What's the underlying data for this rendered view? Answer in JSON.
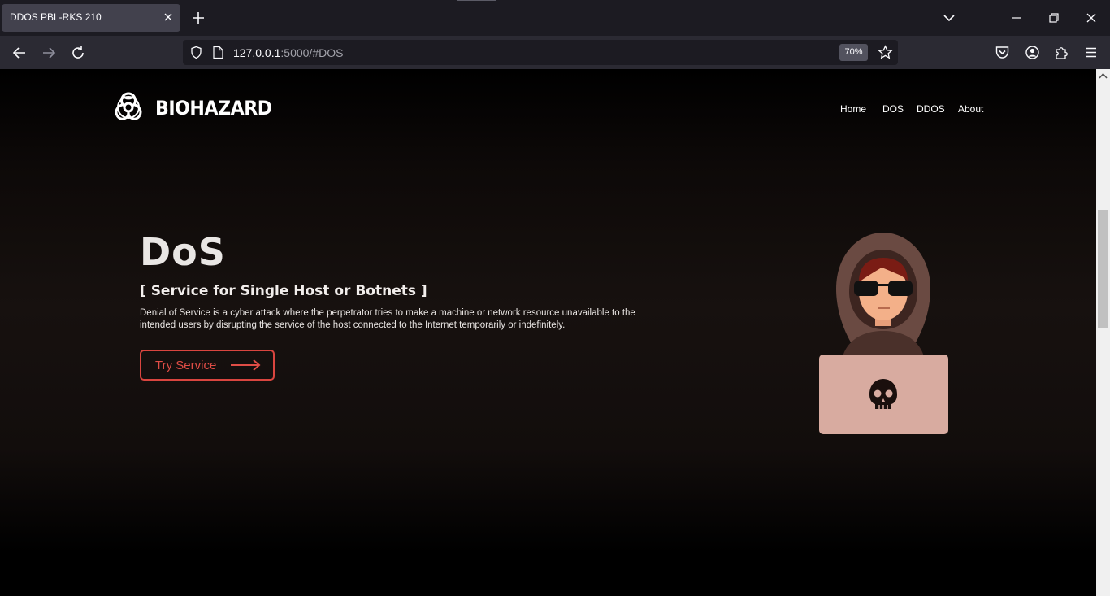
{
  "browser": {
    "tab_title": "DDOS PBL-RKS 210",
    "url_host": "127.0.0.1",
    "url_rest": ":5000/#DOS",
    "zoom": "70%"
  },
  "site": {
    "logo_text": "BIOHAZARD",
    "nav": [
      "Home",
      "DOS",
      "DDOS",
      "About"
    ]
  },
  "hero": {
    "title": "DoS",
    "subtitle": "[ Service for Single Host or Botnets ]",
    "description_line1": "Denial of Service is a cyber attack where the perpetrator tries to make a machine or network resource unavailable to the",
    "description_line2": "intended users by disrupting the service of the host connected to the Internet temporarily or indefinitely.",
    "cta_label": "Try Service"
  },
  "colors": {
    "accent": "#d9453f",
    "chrome_dark": "#1c1b22",
    "chrome_bar": "#2b2a33",
    "laptop": "#d8aba0"
  },
  "icons": [
    "shield-icon",
    "page-icon",
    "star-icon",
    "pocket-icon",
    "account-icon",
    "extensions-icon",
    "menu-icon",
    "skull-icon",
    "biohazard-icon"
  ]
}
